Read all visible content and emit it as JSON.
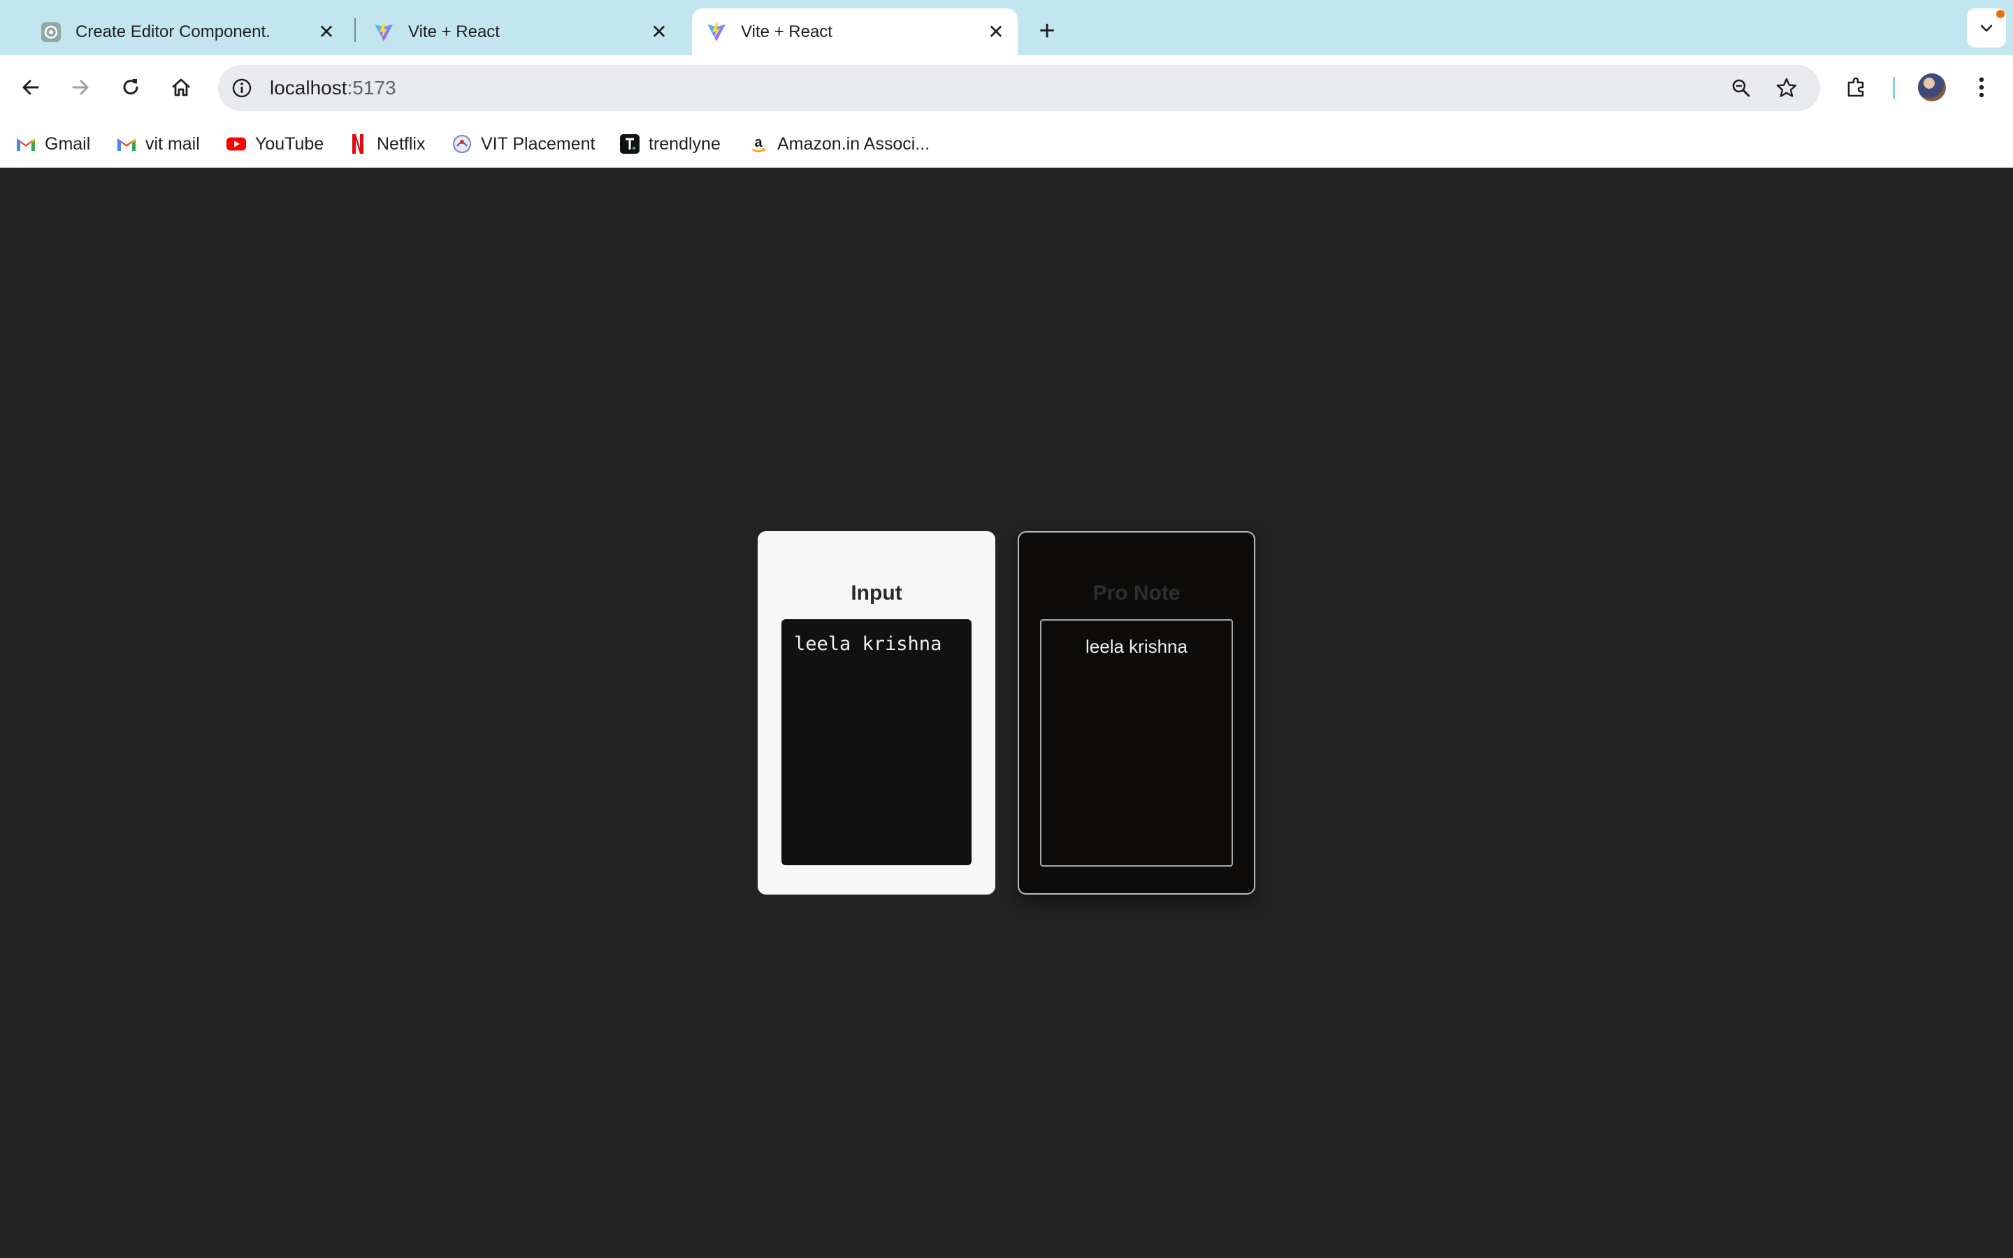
{
  "browser": {
    "tabs": [
      {
        "title": "Create Editor Component.",
        "favicon": "chatgpt-icon",
        "active": false
      },
      {
        "title": "Vite + React",
        "favicon": "vite-icon",
        "active": false
      },
      {
        "title": "Vite + React",
        "favicon": "vite-icon",
        "active": true
      }
    ],
    "new_tab_label": "+",
    "address": {
      "host": "localhost",
      "port": ":5173"
    },
    "bookmarks": [
      {
        "label": "Gmail",
        "icon": "gmail-icon"
      },
      {
        "label": "vit mail",
        "icon": "gmail-icon"
      },
      {
        "label": "YouTube",
        "icon": "youtube-icon"
      },
      {
        "label": "Netflix",
        "icon": "netflix-icon"
      },
      {
        "label": "VIT Placement",
        "icon": "vit-icon"
      },
      {
        "label": "trendlyne",
        "icon": "trendlyne-icon"
      },
      {
        "label": "Amazon.in Associ...",
        "icon": "amazon-icon"
      }
    ]
  },
  "app": {
    "input_card": {
      "title": "Input",
      "editor_value": "leela krishna"
    },
    "note_card": {
      "title": "Pro Note",
      "content": "leela krishna"
    }
  },
  "colors": {
    "tabstrip_bg": "#c3e5ef",
    "page_bg": "#232323",
    "input_card_bg": "#f7f7f7",
    "note_card_bg": "#0d0c0b"
  }
}
